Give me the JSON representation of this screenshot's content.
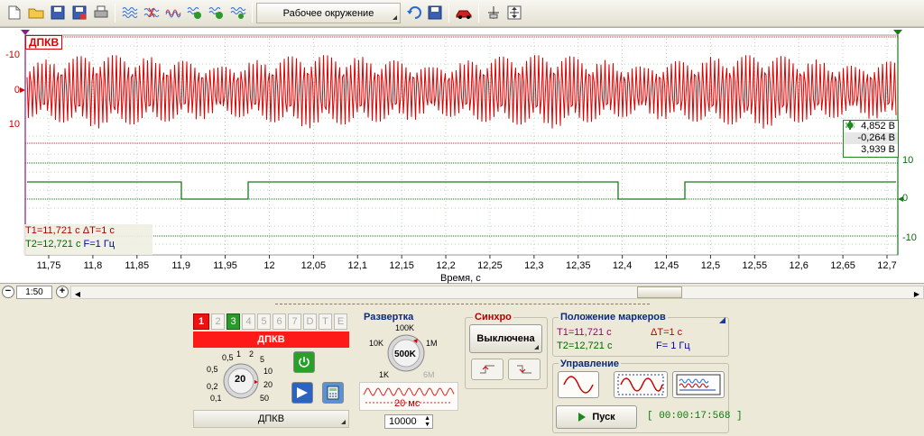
{
  "toolbar": {
    "environment_label": "Рабочее окружение"
  },
  "plot": {
    "channel_tag": "ДПКВ",
    "y_red_ticks": [
      "-10",
      "0",
      "10"
    ],
    "y_green_ticks": [
      "10",
      "0",
      "-10"
    ],
    "x_ticks": [
      "11,75",
      "11,8",
      "11,85",
      "11,9",
      "11,95",
      "12",
      "12,05",
      "12,1",
      "12,15",
      "12,2",
      "12,25",
      "12,3",
      "12,35",
      "12,4",
      "12,45",
      "12,5",
      "12,55",
      "12,6",
      "12,65",
      "12,7"
    ],
    "x_label": "Время, с",
    "markers": {
      "t1": "T1=11,721 с",
      "dt": "ΔT=1 с",
      "t2": "T2=12,721 с",
      "f": "F=1 Гц"
    },
    "measure": {
      "max": "4,852 В",
      "min": "-0,264 В",
      "avg": "3,939 В"
    },
    "colors": {
      "signal": "#dd0000",
      "logic": "#1a7a1a",
      "marker": "#8b1a8b"
    }
  },
  "scroll": {
    "zoom": "1:50"
  },
  "channel": {
    "tabs": [
      "1",
      "2",
      "3",
      "4",
      "5",
      "6",
      "7",
      "D",
      "T",
      "E"
    ],
    "active_tab": "1",
    "name": "ДПКВ",
    "knob_value": "20",
    "knob_labels": [
      "1",
      "2",
      "5",
      "10",
      "20",
      "50",
      "0,5",
      "0,2",
      "0,1"
    ],
    "footer": "ДПКВ"
  },
  "sweep": {
    "title": "Развертка",
    "knob_value": "500K",
    "knob_labels": [
      "100K",
      "1M",
      "6M",
      "1K",
      "10K"
    ],
    "time": "20 мс",
    "points": "10000"
  },
  "sync": {
    "title": "Синхро",
    "state": "Выключена"
  },
  "marker_panel": {
    "title": "Положение маркеров",
    "t1": "T1=11,721 с",
    "dt": "ΔT=1 с",
    "t2": "T2=12,721 с",
    "f": "F= 1 Гц"
  },
  "control": {
    "title": "Управление",
    "start": "Пуск",
    "timer": "[ 00:00:17:568 ]"
  }
}
